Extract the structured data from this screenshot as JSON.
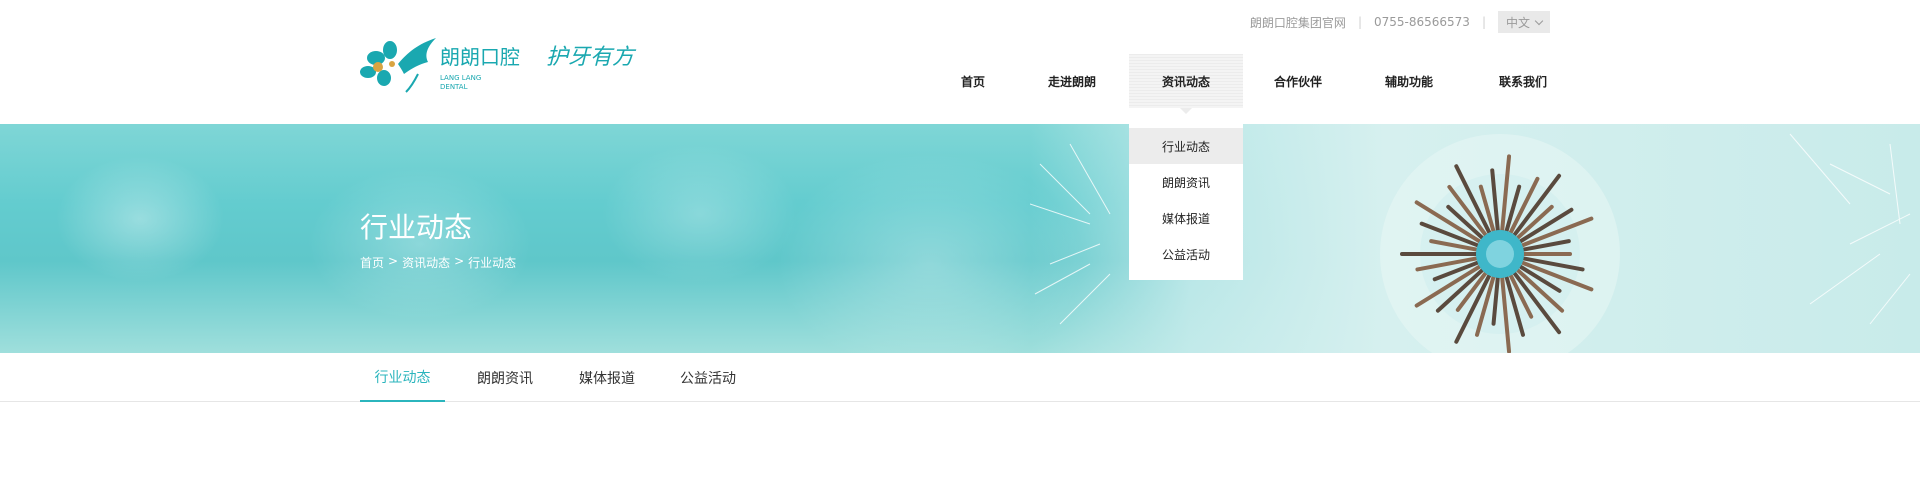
{
  "brand": {
    "name_cn": "朗朗口腔",
    "name_en_line1": "LANG LANG",
    "name_en_line2": "DENTAL",
    "slogan": "护牙有方",
    "accent": "#2bb5bd",
    "logo_color": "#1aa8b0"
  },
  "utility": {
    "site_link": "朗朗口腔集团官网",
    "phone": "0755-86566573",
    "language": "中文"
  },
  "nav": {
    "items": [
      {
        "label": "首页"
      },
      {
        "label": "走进朗朗"
      },
      {
        "label": "资讯动态"
      },
      {
        "label": "合作伙伴"
      },
      {
        "label": "辅助功能"
      },
      {
        "label": "联系我们"
      }
    ],
    "active_index": 2
  },
  "dropdown": {
    "items": [
      {
        "label": "行业动态"
      },
      {
        "label": "朗朗资讯"
      },
      {
        "label": "媒体报道"
      },
      {
        "label": "公益活动"
      }
    ]
  },
  "hero": {
    "title": "行业动态",
    "breadcrumb": [
      "首页",
      ">",
      "资讯动态",
      ">",
      "行业动态"
    ]
  },
  "subtabs": {
    "items": [
      {
        "label": "行业动态"
      },
      {
        "label": "朗朗资讯"
      },
      {
        "label": "媒体报道"
      },
      {
        "label": "公益活动"
      }
    ]
  }
}
